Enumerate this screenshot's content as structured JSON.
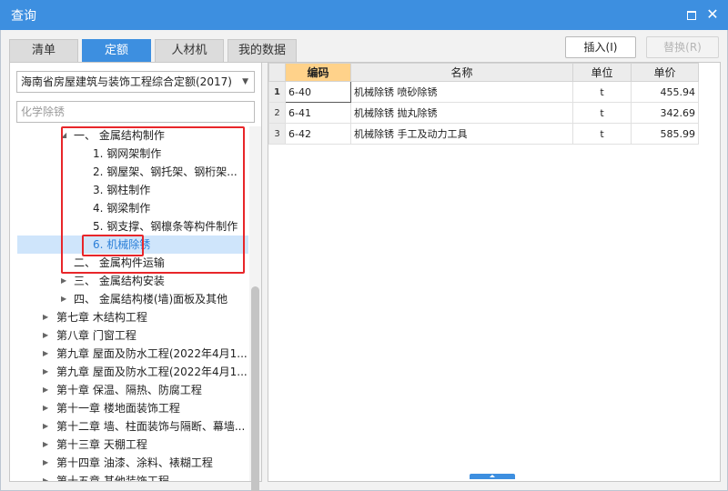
{
  "window": {
    "title": "查询"
  },
  "tabs": [
    {
      "label": "清单"
    },
    {
      "label": "定额"
    },
    {
      "label": "人材机"
    },
    {
      "label": "我的数据"
    }
  ],
  "toolbar": {
    "insert_label": "插入(I)",
    "replace_label": "替换(R)"
  },
  "left": {
    "library_selected": "海南省房屋建筑与装饰工程综合定额(2017)",
    "search_placeholder": "化学除锈"
  },
  "tree": [
    {
      "label": "一、 金属结构制作"
    },
    {
      "label": "1. 钢网架制作"
    },
    {
      "label": "2. 钢屋架、钢托架、钢桁架..."
    },
    {
      "label": "3. 钢柱制作"
    },
    {
      "label": "4. 钢梁制作"
    },
    {
      "label": "5. 钢支撑、钢檩条等构件制作"
    },
    {
      "label": "6. 机械除锈"
    },
    {
      "label": "二、 金属构件运输"
    },
    {
      "label": "三、 金属结构安装"
    },
    {
      "label": "四、 金属结构楼(墙)面板及其他"
    },
    {
      "label": "第七章 木结构工程"
    },
    {
      "label": "第八章 门窗工程"
    },
    {
      "label": "第九章 屋面及防水工程(2022年4月1..."
    },
    {
      "label": "第九章 屋面及防水工程(2022年4月1..."
    },
    {
      "label": "第十章 保温、隔热、防腐工程"
    },
    {
      "label": "第十一章 楼地面装饰工程"
    },
    {
      "label": "第十二章 墙、柱面装饰与隔断、幕墙..."
    },
    {
      "label": "第十三章 天棚工程"
    },
    {
      "label": "第十四章 油漆、涂料、裱糊工程"
    },
    {
      "label": "第十五章 其他装饰工程"
    }
  ],
  "grid": {
    "headers": {
      "code": "编码",
      "name": "名称",
      "unit": "单位",
      "price": "单价"
    },
    "rows": [
      {
        "no": "1",
        "code": "6-40",
        "name": "机械除锈 喷砂除锈",
        "unit": "t",
        "price": "455.94"
      },
      {
        "no": "2",
        "code": "6-41",
        "name": "机械除锈 抛丸除锈",
        "unit": "t",
        "price": "342.69"
      },
      {
        "no": "3",
        "code": "6-42",
        "name": "机械除锈 手工及动力工具",
        "unit": "t",
        "price": "585.99"
      }
    ]
  },
  "colors": {
    "accent": "#3d8fe0",
    "highlight_box": "#e8262a",
    "selected_row": "#cfe5fb"
  },
  "icons": {
    "maximize": "maximize-icon",
    "close": "close-icon",
    "expand": "triangle-right-icon",
    "collapse": "triangle-down-icon"
  }
}
